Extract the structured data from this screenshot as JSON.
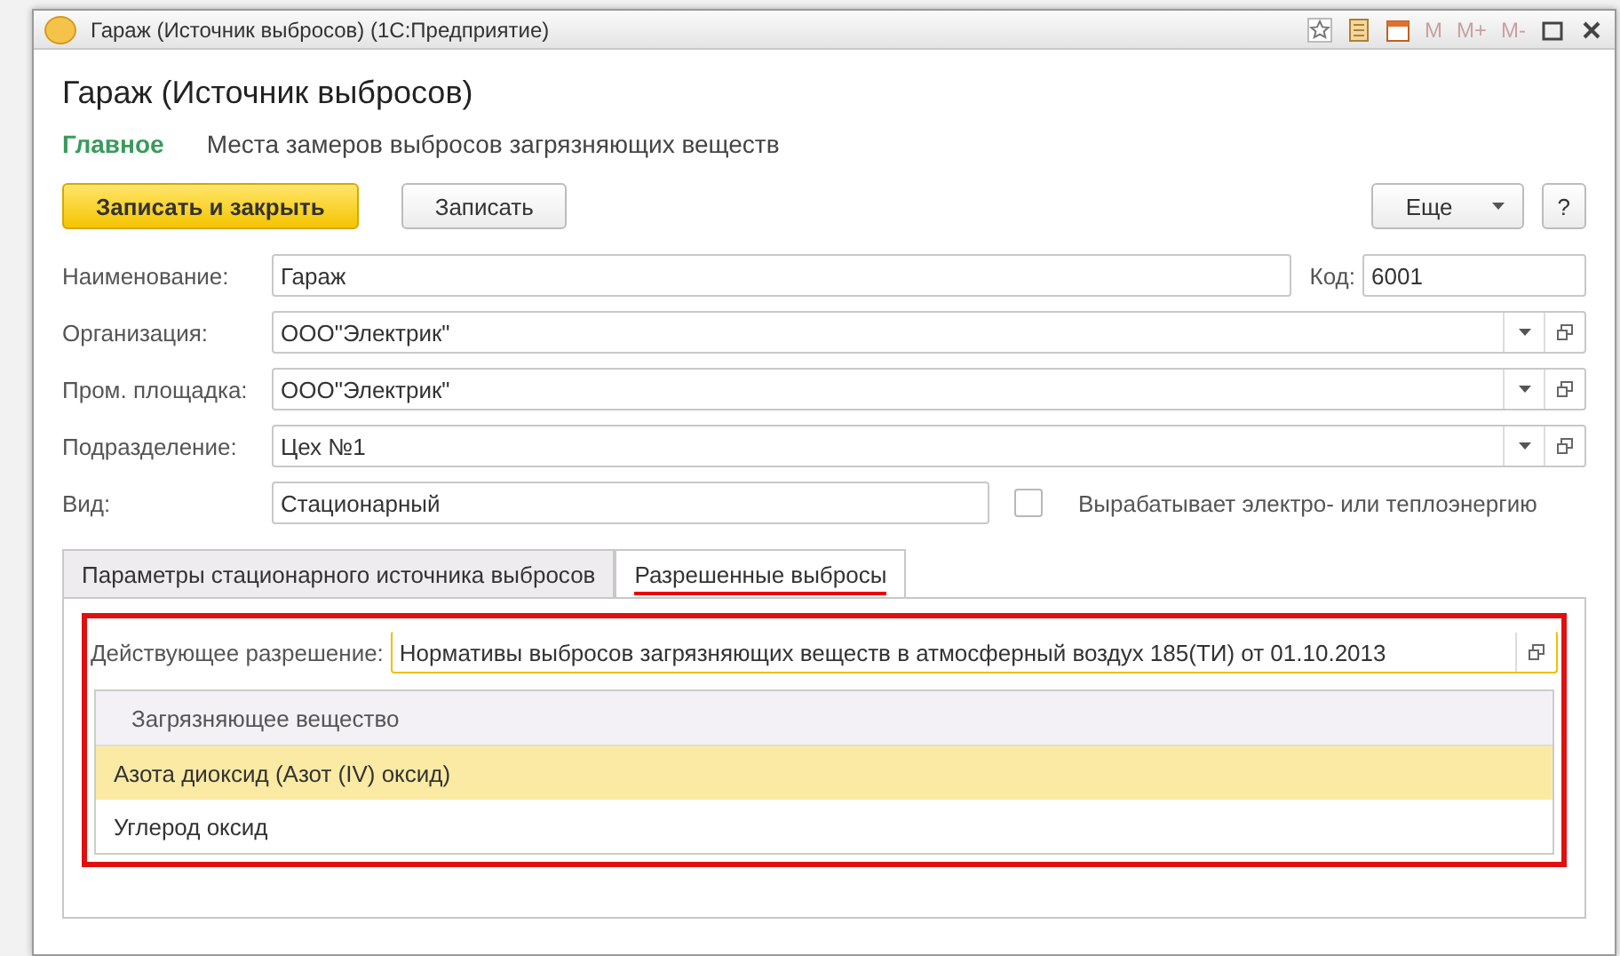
{
  "window": {
    "title": "Гараж (Источник выбросов)  (1С:Предприятие)",
    "memory_buttons": [
      "M",
      "M+",
      "M-"
    ]
  },
  "header": {
    "title": "Гараж (Источник выбросов)"
  },
  "nav": [
    {
      "label": "Главное",
      "selected": true
    },
    {
      "label": "Места замеров выбросов загрязняющих веществ",
      "selected": false
    }
  ],
  "toolbar": {
    "primary": "Записать и закрыть",
    "secondary": "Записать",
    "more": "Еще",
    "help": "?"
  },
  "name_row": {
    "label": "Наименование:",
    "value": "Гараж",
    "code_label": "Код:",
    "code_value": "6001"
  },
  "fields": [
    {
      "label": "Организация:",
      "value": "ООО\"Электрик\""
    },
    {
      "label": "Пром. площадка:",
      "value": "ООО\"Электрик\""
    },
    {
      "label": "Подразделение:",
      "value": "Цех №1"
    }
  ],
  "kind_row": {
    "label": "Вид:",
    "value": "Стационарный",
    "checkbox_label": "Вырабатывает электро- или теплоэнергию",
    "checked": false
  },
  "tabs": [
    {
      "label": "Параметры стационарного источника выбросов",
      "selected": false
    },
    {
      "label": "Разрешенные выбросы",
      "selected": true
    }
  ],
  "permit": {
    "label": "Действующее разрешение:",
    "value": "Нормативы выбросов загрязняющих веществ в атмосферный воздух 185(ТИ) от 01.10.2013"
  },
  "table": {
    "columns": [
      "Загрязняющее вещество"
    ],
    "rows": [
      {
        "cells": [
          "Азота диоксид (Азот (IV) оксид)"
        ],
        "selected": true
      },
      {
        "cells": [
          "Углерод оксид"
        ],
        "selected": false
      }
    ]
  }
}
